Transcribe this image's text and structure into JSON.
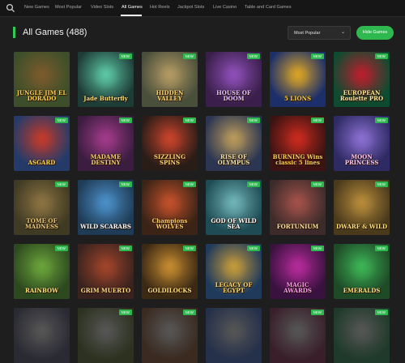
{
  "nav": {
    "items": [
      "New Games",
      "Most Popular",
      "Video Slots",
      "All Games",
      "Hot Reels",
      "Jackpot Slots",
      "Live Casino",
      "Table and Card Games"
    ],
    "active": "All Games"
  },
  "header": {
    "title": "All Games (488)",
    "sort_value": "Most Popular",
    "hide_button": "Hide Games"
  },
  "games": [
    {
      "name": "JUNGLE JIM EL DORADO",
      "new": false,
      "bg": "#3c4f2a",
      "fg": "#7a5a2c",
      "color": "#ffd04a"
    },
    {
      "name": "Jade Butterfly",
      "new": true,
      "bg": "#1e3c36",
      "fg": "#5cc7a4",
      "color": "#f5dd7a"
    },
    {
      "name": "HIDDEN VALLEY",
      "new": true,
      "bg": "#4a4f3c",
      "fg": "#b39a62",
      "color": "#ffd66b"
    },
    {
      "name": "HOUSE OF DOOM",
      "new": true,
      "bg": "#3a1f4a",
      "fg": "#8e4fb8",
      "color": "#e7c6ff"
    },
    {
      "name": "5 LIONS",
      "new": true,
      "bg": "#1c2f6a",
      "fg": "#d9a326",
      "color": "#ffcf3a"
    },
    {
      "name": "EUROPEAN Roulette PRO",
      "new": true,
      "bg": "#0f4b30",
      "fg": "#b81f2e",
      "color": "#ffe89a"
    },
    {
      "name": "ASGARD",
      "new": true,
      "bg": "#243b69",
      "fg": "#c23a2a",
      "color": "#ffd54a"
    },
    {
      "name": "MADAME DESTINY",
      "new": true,
      "bg": "#3a1d3f",
      "fg": "#a23a8a",
      "color": "#f7d36a"
    },
    {
      "name": "SIZZLING SPINS",
      "new": true,
      "bg": "#2a1d18",
      "fg": "#c8432a",
      "color": "#ffd772"
    },
    {
      "name": "RISE OF OLYMPUS",
      "new": true,
      "bg": "#2c3652",
      "fg": "#b99a5b",
      "color": "#f3e3a8"
    },
    {
      "name": "BURNING Wins classic 5 lines",
      "new": true,
      "bg": "#3a1312",
      "fg": "#c92a1e",
      "color": "#ffd05a"
    },
    {
      "name": "MOON PRINCESS",
      "new": true,
      "bg": "#2e2a63",
      "fg": "#8a6fd1",
      "color": "#ffc7f0"
    },
    {
      "name": "TOME OF MADNESS",
      "new": true,
      "bg": "#3f3a23",
      "fg": "#8b7342",
      "color": "#e9c778"
    },
    {
      "name": "WILD SCARABS",
      "new": true,
      "bg": "#1f3b55",
      "fg": "#4a8fc8",
      "color": "#ffffff"
    },
    {
      "name": "Champions WOLVES",
      "new": true,
      "bg": "#3b2416",
      "fg": "#c2502a",
      "color": "#ffcf6a"
    },
    {
      "name": "GOD OF WILD SEA",
      "new": true,
      "bg": "#1f4c54",
      "fg": "#6fb3b8",
      "color": "#ffffff"
    },
    {
      "name": "FORTUNIUM",
      "new": true,
      "bg": "#3c2b2a",
      "fg": "#a2514a",
      "color": "#ffe09a"
    },
    {
      "name": "DWARF & WILD",
      "new": true,
      "bg": "#4a3a1c",
      "fg": "#b78b3a",
      "color": "#ffe07a"
    },
    {
      "name": "RAINBOW",
      "new": true,
      "bg": "#2d4a1f",
      "fg": "#6aa33a",
      "color": "#ffe27a"
    },
    {
      "name": "GRIM MUERTO",
      "new": true,
      "bg": "#3a231f",
      "fg": "#a0442a",
      "color": "#ffd98a"
    },
    {
      "name": "GOLDILOCKS",
      "new": true,
      "bg": "#3b2914",
      "fg": "#c48a2f",
      "color": "#ffe07a"
    },
    {
      "name": "LEGACY OF EGYPT",
      "new": true,
      "bg": "#1f3a5b",
      "fg": "#c49a3a",
      "color": "#ffd966"
    },
    {
      "name": "MAGIC AWARDS",
      "new": true,
      "bg": "#3a1240",
      "fg": "#b52a9a",
      "color": "#ff9bf0"
    },
    {
      "name": "EMERALDS",
      "new": true,
      "bg": "#1e4a27",
      "fg": "#3cb455",
      "color": "#ffe07a"
    },
    {
      "name": "",
      "new": false,
      "bg": "#2a2a33",
      "fg": "#555",
      "color": "#fff"
    },
    {
      "name": "",
      "new": true,
      "bg": "#2d3220",
      "fg": "#555",
      "color": "#fff"
    },
    {
      "name": "",
      "new": true,
      "bg": "#3a2a20",
      "fg": "#555",
      "color": "#fff"
    },
    {
      "name": "",
      "new": false,
      "bg": "#25304a",
      "fg": "#555",
      "color": "#fff"
    },
    {
      "name": "",
      "new": true,
      "bg": "#3a1f2a",
      "fg": "#555",
      "color": "#fff"
    },
    {
      "name": "",
      "new": true,
      "bg": "#1f3a2a",
      "fg": "#555",
      "color": "#fff"
    }
  ],
  "new_label": "NEW",
  "accent": "#2fb84f"
}
